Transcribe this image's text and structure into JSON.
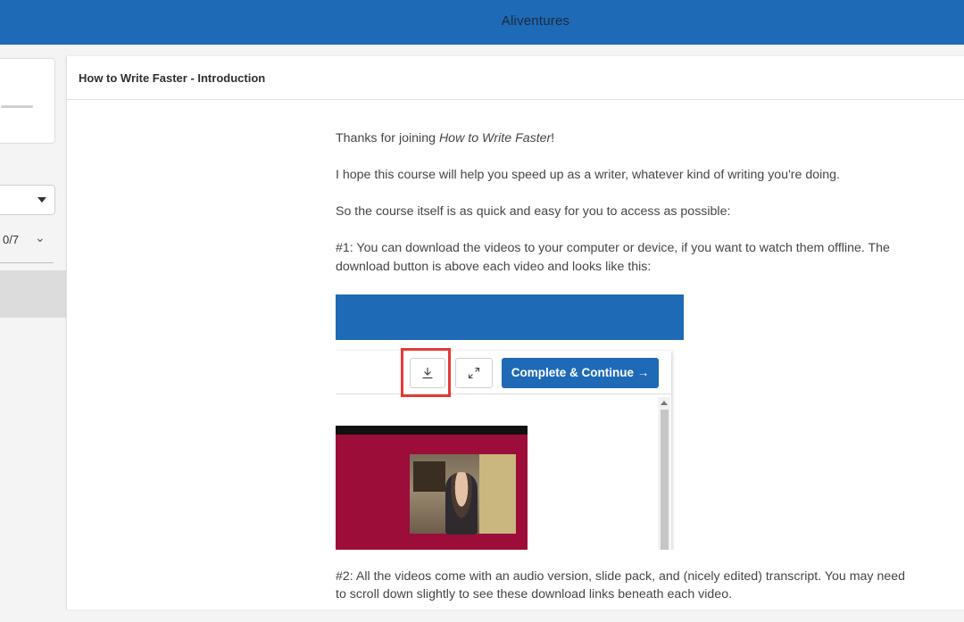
{
  "app": {
    "title": "Aliventures"
  },
  "sidebar": {
    "section_progress": "0/7",
    "icons": {
      "select_caret": "caret-down-icon",
      "section_chevron": "chevron-down-icon"
    }
  },
  "lesson": {
    "title": "How to Write Faster - Introduction",
    "intro_prefix": "Thanks for joining ",
    "intro_course": "How to Write Faster",
    "intro_suffix": "!",
    "p2": "I hope this course will help you speed up as a writer, whatever kind of writing you're doing.",
    "p3": "So the course itself is as quick and easy for you to access as possible:",
    "p4": "#1: You can download the videos to your computer or device, if you want to watch them offline. The download button is above each video and looks like this:",
    "p5": "#2: All the videos come with an audio version, slide pack, and (nicely edited) transcript. You may need to scroll down slightly to see these download links beneath each video."
  },
  "embedded_screenshot": {
    "complete_button_label": "Complete & Continue →",
    "icons": {
      "download": "download-icon",
      "fullscreen": "expand-icon"
    },
    "colors": {
      "brand_blue": "#1f6ab6",
      "highlight_red": "#e53935",
      "video_bg": "#9c0d3a"
    }
  }
}
